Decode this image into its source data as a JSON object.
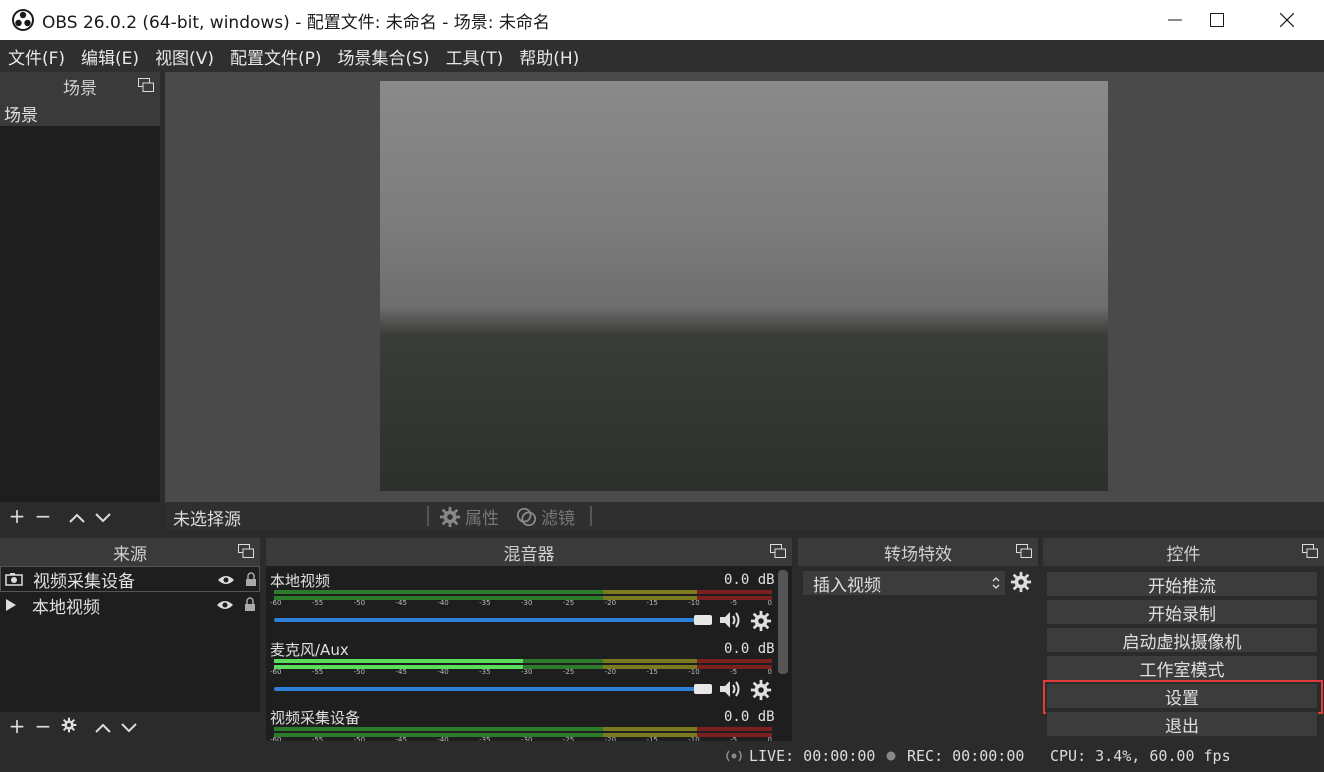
{
  "window": {
    "title": "OBS 26.0.2 (64-bit, windows) - 配置文件: 未命名 - 场景: 未命名"
  },
  "menu": [
    "文件(F)",
    "编辑(E)",
    "视图(V)",
    "配置文件(P)",
    "场景集合(S)",
    "工具(T)",
    "帮助(H)"
  ],
  "scenes": {
    "title": "场景",
    "items": [
      "场景"
    ]
  },
  "source_toolbar": {
    "no_source": "未选择源",
    "properties": "属性",
    "filters": "滤镜"
  },
  "sources": {
    "title": "来源",
    "items": [
      "视频采集设备",
      "本地视频"
    ]
  },
  "mixer": {
    "title": "混音器",
    "channels": [
      {
        "name": "本地视频",
        "db": "0.0 dB",
        "level": 0.0
      },
      {
        "name": "麦克风/Aux",
        "db": "0.0 dB",
        "level": 0.5
      },
      {
        "name": "视频采集设备",
        "db": "0.0 dB",
        "level": 0.0
      }
    ],
    "scale": [
      "-60",
      "-55",
      "-50",
      "-45",
      "-40",
      "-35",
      "-30",
      "-25",
      "-20",
      "-15",
      "-10",
      "-5",
      "0"
    ]
  },
  "transitions": {
    "title": "转场特效",
    "selected": "插入视频"
  },
  "controls": {
    "title": "控件",
    "buttons": [
      "开始推流",
      "开始录制",
      "启动虚拟摄像机",
      "工作室模式",
      "设置",
      "退出"
    ]
  },
  "status": {
    "live": "LIVE: 00:00:00",
    "rec": "REC: 00:00:00",
    "cpu": "CPU: 3.4%, 60.00 fps"
  },
  "colors": {
    "highlight_border": "#e03c3c",
    "volume": "#2e7fd8"
  }
}
